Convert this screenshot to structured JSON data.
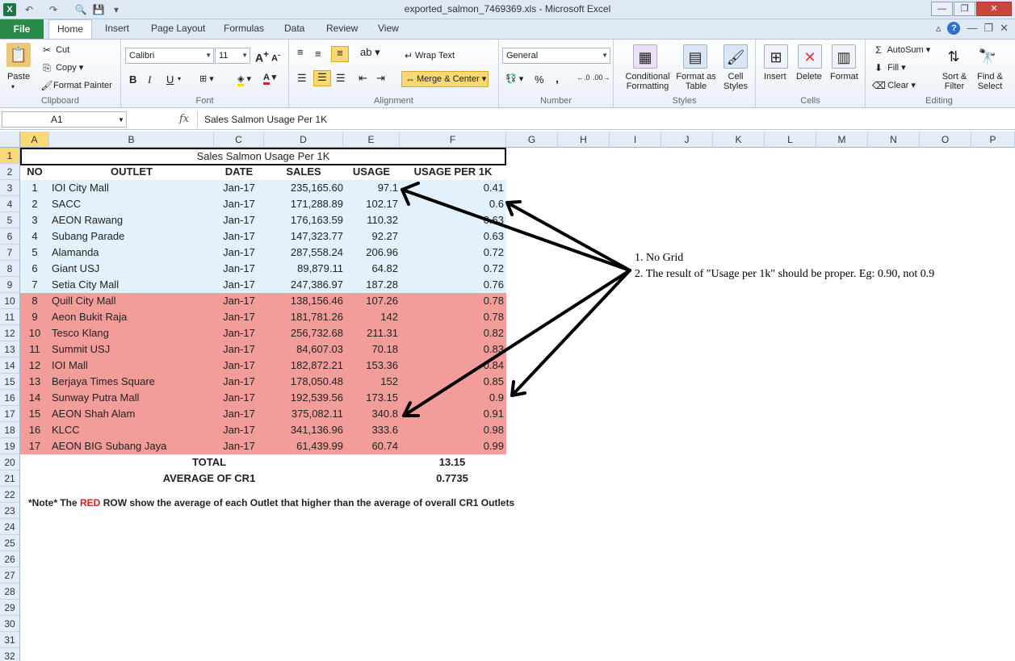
{
  "window": {
    "title": "exported_salmon_7469369.xls - Microsoft Excel",
    "app_logo": "X",
    "quick_access": [
      "undo-icon",
      "redo-icon",
      "print-preview-icon",
      "save-icon",
      "customize-icon"
    ]
  },
  "tabs": {
    "file": "File",
    "items": [
      "Home",
      "Insert",
      "Page Layout",
      "Formulas",
      "Data",
      "Review",
      "View"
    ],
    "active": "Home"
  },
  "ribbon": {
    "clipboard": {
      "label": "Clipboard",
      "paste": "Paste",
      "cut": "Cut",
      "copy": "Copy",
      "format_painter": "Format Painter"
    },
    "font": {
      "label": "Font",
      "name": "Calibri",
      "size": "11",
      "bold": "B",
      "italic": "I",
      "underline": "U"
    },
    "alignment": {
      "label": "Alignment",
      "wrap_text": "Wrap Text",
      "merge_center": "Merge & Center"
    },
    "number": {
      "label": "Number",
      "format": "General",
      "percent": "%",
      "comma": ","
    },
    "styles": {
      "label": "Styles",
      "conditional": "Conditional Formatting",
      "format_table": "Format as Table",
      "cell_styles": "Cell Styles"
    },
    "cells": {
      "label": "Cells",
      "insert": "Insert",
      "delete": "Delete",
      "format": "Format"
    },
    "editing": {
      "label": "Editing",
      "autosum": "AutoSum",
      "fill": "Fill",
      "clear": "Clear",
      "sort_filter": "Sort & Filter",
      "find_select": "Find & Select"
    }
  },
  "formula_bar": {
    "name_box": "A1",
    "fx": "fx",
    "content": "Sales Salmon Usage Per 1K"
  },
  "columns": [
    "A",
    "B",
    "C",
    "D",
    "E",
    "F",
    "G",
    "H",
    "I",
    "J",
    "K",
    "L",
    "M",
    "N",
    "O",
    "P"
  ],
  "rows": [
    "1",
    "2",
    "3",
    "4",
    "5",
    "6",
    "7",
    "8",
    "9",
    "10",
    "11",
    "12",
    "13",
    "14",
    "15",
    "16",
    "17",
    "18",
    "19",
    "20",
    "21",
    "22",
    "23",
    "24",
    "25",
    "26",
    "27",
    "28",
    "29",
    "30",
    "31",
    "32"
  ],
  "sheet": {
    "title": "Sales Salmon Usage Per 1K",
    "headers": {
      "no": "NO",
      "outlet": "OUTLET",
      "date": "DATE",
      "sales": "SALES",
      "usage": "USAGE",
      "usage_per_1k": "USAGE PER 1K"
    },
    "records": [
      {
        "no": "1",
        "outlet": "IOI City Mall",
        "date": "Jan-17",
        "sales": "235,165.60",
        "usage": "97.1",
        "per1k": "0.41",
        "band": "blue"
      },
      {
        "no": "2",
        "outlet": "SACC",
        "date": "Jan-17",
        "sales": "171,288.89",
        "usage": "102.17",
        "per1k": "0.6",
        "band": "blue"
      },
      {
        "no": "3",
        "outlet": "AEON Rawang",
        "date": "Jan-17",
        "sales": "176,163.59",
        "usage": "110.32",
        "per1k": "0.63",
        "band": "blue"
      },
      {
        "no": "4",
        "outlet": "Subang Parade",
        "date": "Jan-17",
        "sales": "147,323.77",
        "usage": "92.27",
        "per1k": "0.63",
        "band": "blue"
      },
      {
        "no": "5",
        "outlet": "Alamanda",
        "date": "Jan-17",
        "sales": "287,558.24",
        "usage": "206.96",
        "per1k": "0.72",
        "band": "blue"
      },
      {
        "no": "6",
        "outlet": "Giant USJ",
        "date": "Jan-17",
        "sales": "89,879.11",
        "usage": "64.82",
        "per1k": "0.72",
        "band": "blue"
      },
      {
        "no": "7",
        "outlet": "Setia City Mall",
        "date": "Jan-17",
        "sales": "247,386.97",
        "usage": "187.28",
        "per1k": "0.76",
        "band": "blue"
      },
      {
        "no": "8",
        "outlet": "Quill City Mall",
        "date": "Jan-17",
        "sales": "138,156.46",
        "usage": "107.26",
        "per1k": "0.78",
        "band": "red"
      },
      {
        "no": "9",
        "outlet": "Aeon Bukit Raja",
        "date": "Jan-17",
        "sales": "181,781.26",
        "usage": "142",
        "per1k": "0.78",
        "band": "red"
      },
      {
        "no": "10",
        "outlet": "Tesco Klang",
        "date": "Jan-17",
        "sales": "256,732.68",
        "usage": "211.31",
        "per1k": "0.82",
        "band": "red"
      },
      {
        "no": "11",
        "outlet": "Summit USJ",
        "date": "Jan-17",
        "sales": "84,607.03",
        "usage": "70.18",
        "per1k": "0.83",
        "band": "red"
      },
      {
        "no": "12",
        "outlet": "IOI Mall",
        "date": "Jan-17",
        "sales": "182,872.21",
        "usage": "153.36",
        "per1k": "0.84",
        "band": "red"
      },
      {
        "no": "13",
        "outlet": "Berjaya Times Square",
        "date": "Jan-17",
        "sales": "178,050.48",
        "usage": "152",
        "per1k": "0.85",
        "band": "red"
      },
      {
        "no": "14",
        "outlet": "Sunway Putra Mall",
        "date": "Jan-17",
        "sales": "192,539.56",
        "usage": "173.15",
        "per1k": "0.9",
        "band": "red"
      },
      {
        "no": "15",
        "outlet": "AEON Shah Alam",
        "date": "Jan-17",
        "sales": "375,082.11",
        "usage": "340.8",
        "per1k": "0.91",
        "band": "red"
      },
      {
        "no": "16",
        "outlet": "KLCC",
        "date": "Jan-17",
        "sales": "341,136.96",
        "usage": "333.6",
        "per1k": "0.98",
        "band": "red"
      },
      {
        "no": "17",
        "outlet": "AEON BIG Subang Jaya",
        "date": "Jan-17",
        "sales": "61,439.99",
        "usage": "60.74",
        "per1k": "0.99",
        "band": "red"
      }
    ],
    "total": {
      "label": "TOTAL",
      "value": "13.15"
    },
    "average": {
      "label": "AVERAGE OF CR1",
      "value": "0.7735"
    },
    "note": {
      "prefix": "*Note* The ",
      "red_word": "RED",
      "suffix": " ROW show the average of each Outlet that higher than the average of overall CR1 Outlets"
    }
  },
  "annotation": {
    "line1": "1. No Grid",
    "line2": "2. The result of \"Usage per 1k\" should be proper. Eg: 0.90, not 0.9"
  },
  "colors": {
    "blue_band": "#e2f1fb",
    "red_band": "#f39d9a",
    "note_red": "#d21f1f",
    "file_tab": "#2a8a4a"
  }
}
